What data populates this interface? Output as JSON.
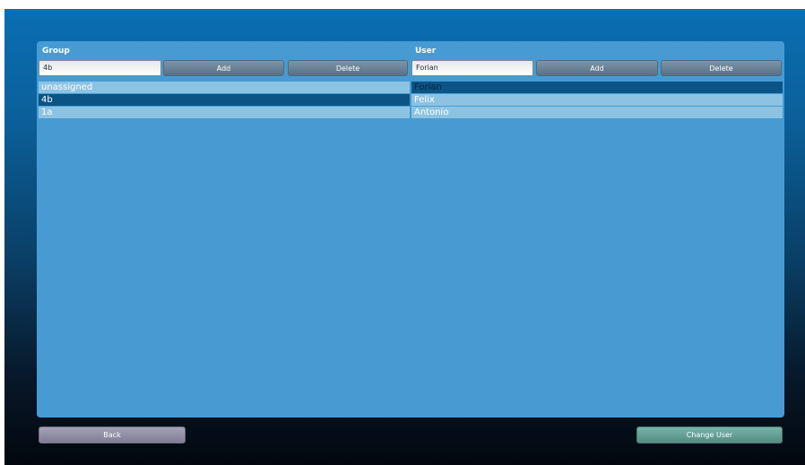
{
  "group": {
    "title": "Group",
    "input_value": "4b",
    "add_label": "Add",
    "delete_label": "Delete",
    "items": [
      {
        "label": "unassigned",
        "selected": false
      },
      {
        "label": "4b",
        "selected": true
      },
      {
        "label": "1a",
        "selected": false
      }
    ]
  },
  "user": {
    "title": "User",
    "input_value": "Forian",
    "add_label": "Add",
    "delete_label": "Delete",
    "items": [
      {
        "label": "Forian",
        "selected": true
      },
      {
        "label": "Felix",
        "selected": false
      },
      {
        "label": "Antonio",
        "selected": false
      }
    ]
  },
  "footer": {
    "back_label": "Back",
    "change_user_label": "Change User"
  },
  "colors": {
    "panel": "#479bd2",
    "row": "#8dc3e2",
    "row_selected": "#0a5486",
    "back_button": "#8c8aa0",
    "change_user_button": "#5f9e94"
  }
}
